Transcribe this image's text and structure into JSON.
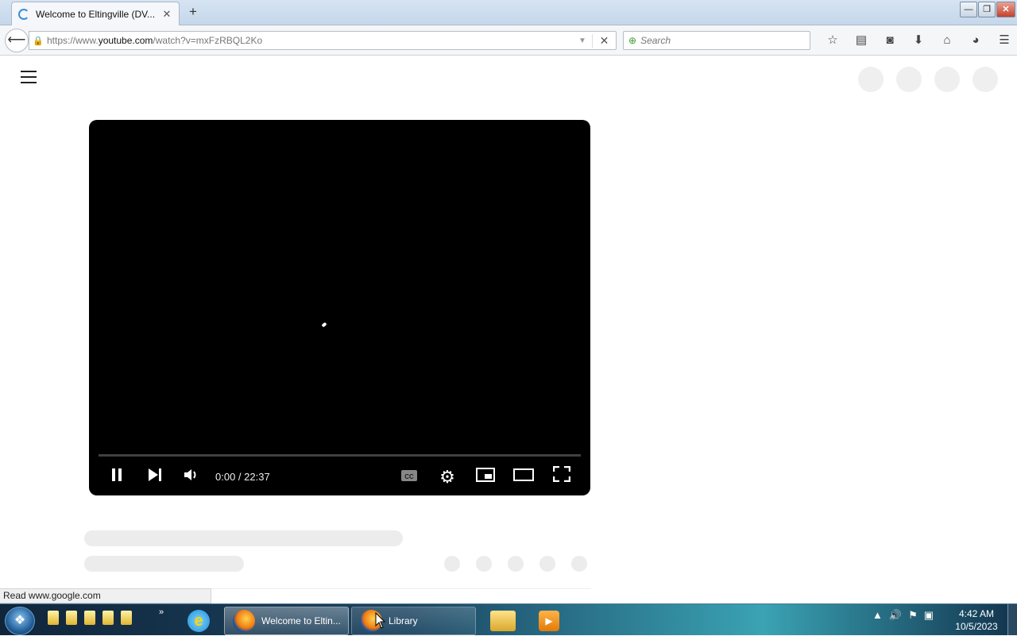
{
  "browser": {
    "tab_title": "Welcome to Eltingville (DV...",
    "tab_close": "✕",
    "new_tab": "+",
    "url_prefix": "https://www.",
    "url_domain": "youtube.com",
    "url_path": "/watch?v=mxFzRBQL2Ko",
    "search_placeholder": "Search",
    "status_text": "Read www.google.com",
    "window_buttons": {
      "minimize": "—",
      "restore": "❐",
      "close": "✕"
    },
    "toolbar_icons": [
      "star-icon",
      "reading-list-icon",
      "pocket-icon",
      "download-icon",
      "home-icon",
      "chat-icon",
      "menu-icon"
    ]
  },
  "player": {
    "time": "0:00 / 22:37",
    "progress": 0.0,
    "state": "paused-button-shown"
  },
  "taskbar": {
    "items": [
      {
        "label": "Welcome to Eltin...",
        "icon": "firefox-icon",
        "state": "active"
      },
      {
        "label": "Library",
        "icon": "firefox-icon",
        "state": "open"
      }
    ],
    "clock_time": "4:42 AM",
    "clock_date": "10/5/2023",
    "more_label": "»"
  }
}
